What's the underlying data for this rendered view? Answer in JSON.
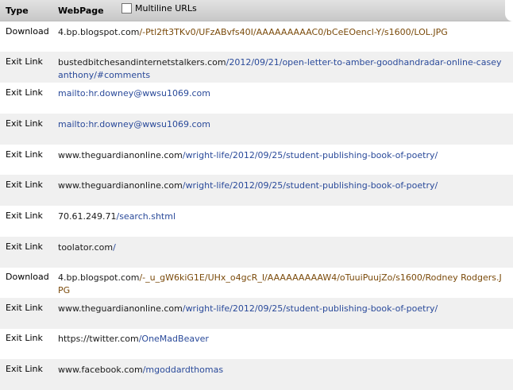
{
  "header": {
    "type_label": "Type",
    "webpage_label": "WebPage",
    "multiline_label": "Multiline URLs"
  },
  "rows": [
    {
      "type": "Download",
      "host": "4.bp.blogspot.com",
      "path": "/-Ptl2ft3TKv0/UFzABvfs40I/AAAAAAAAAC0/bCeEOencl-Y/s1600/LOL.JPG"
    },
    {
      "type": "Exit Link",
      "host": "bustedbitchesandinternetstalkers.com",
      "path": "/2012/09/21/open-letter-to-amber-goodhandradar-online-caseyanthony/#comments"
    },
    {
      "type": "Exit Link",
      "host": "",
      "path": "mailto:hr.downey@wwsu1069.com"
    },
    {
      "type": "Exit Link",
      "host": "",
      "path": "mailto:hr.downey@wwsu1069.com"
    },
    {
      "type": "Exit Link",
      "host": "www.theguardianonline.com",
      "path": "/wright-life/2012/09/25/student-publishing-book-of-poetry/"
    },
    {
      "type": "Exit Link",
      "host": "www.theguardianonline.com",
      "path": "/wright-life/2012/09/25/student-publishing-book-of-poetry/"
    },
    {
      "type": "Exit Link",
      "host": "70.61.249.71",
      "path": "/search.shtml"
    },
    {
      "type": "Exit Link",
      "host": "toolator.com",
      "path": "/"
    },
    {
      "type": "Download",
      "host": "4.bp.blogspot.com",
      "path": "/-_u_gW6kiG1E/UHx_o4gcR_I/AAAAAAAAAW4/oTuuiPuujZo/s1600/Rodney Rodgers.JPG"
    },
    {
      "type": "Exit Link",
      "host": "www.theguardianonline.com",
      "path": "/wright-life/2012/09/25/student-publishing-book-of-poetry/"
    },
    {
      "type": "Exit Link",
      "host": "https://twitter.com",
      "path": "/OneMadBeaver"
    },
    {
      "type": "Exit Link",
      "host": "www.facebook.com",
      "path": "/mgoddardthomas"
    }
  ]
}
